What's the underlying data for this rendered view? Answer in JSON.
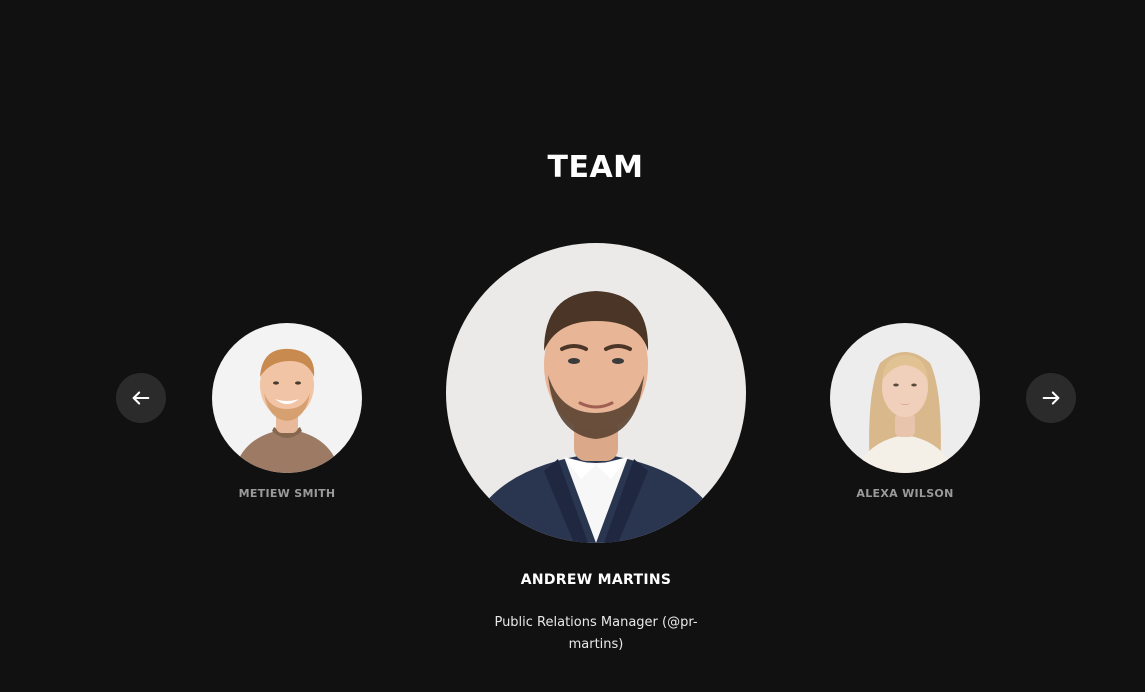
{
  "section": {
    "title": "TEAM"
  },
  "carousel": {
    "prev_icon": "arrow-left-icon",
    "next_icon": "arrow-right-icon",
    "members": [
      {
        "name": "METIEW SMITH",
        "position": "left"
      },
      {
        "name": "ANDREW MARTINS",
        "role": "Public Relations Manager (@pr-martins)",
        "position": "center"
      },
      {
        "name": "ALEXA WILSON",
        "position": "right"
      }
    ]
  },
  "colors": {
    "background": "#111111",
    "nav_button": "#2b2b2b",
    "side_name": "#9a9a9a",
    "primary_text": "#ffffff"
  }
}
